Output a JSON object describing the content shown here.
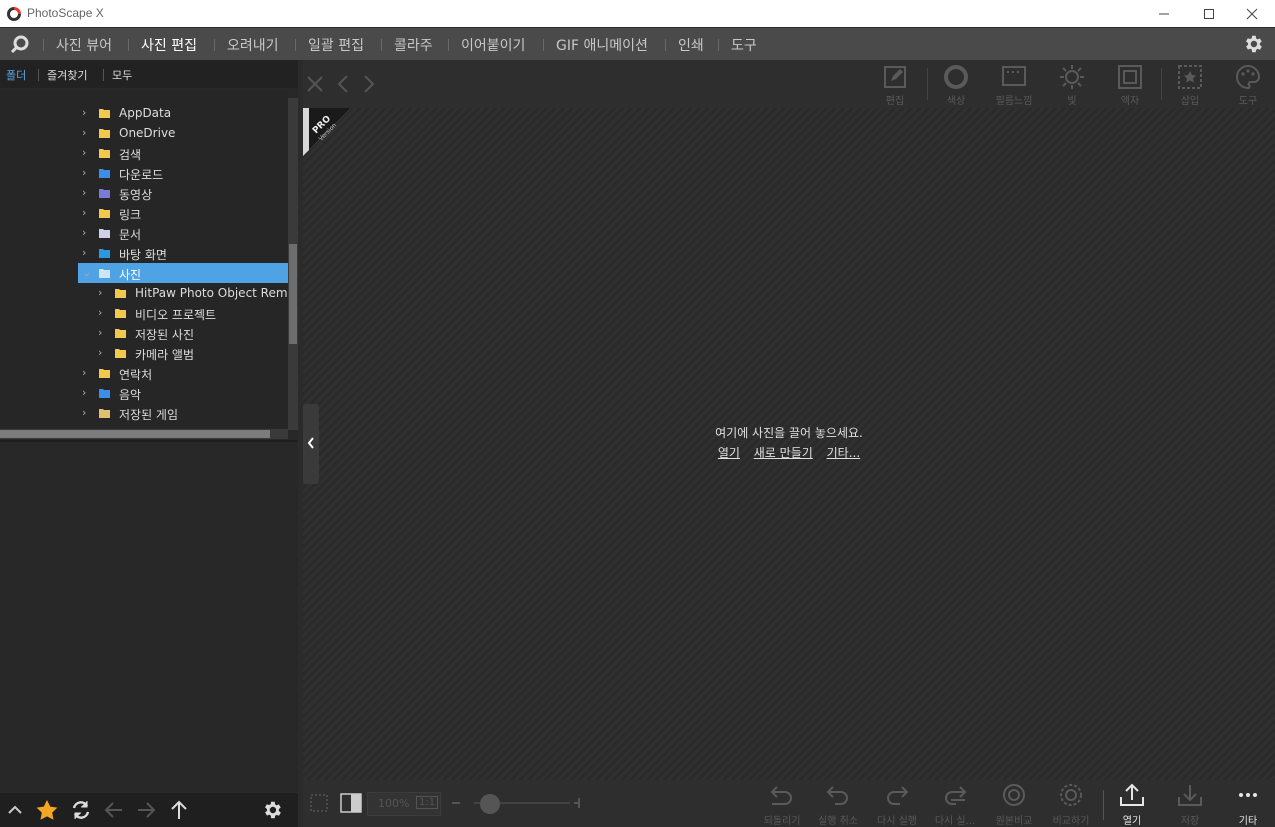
{
  "app": {
    "title": "PhotoScape X"
  },
  "menu": {
    "items": [
      "사진 뷰어",
      "사진 편집",
      "오려내기",
      "일괄 편집",
      "콜라주",
      "이어붙이기",
      "GIF 애니메이션",
      "인쇄",
      "도구"
    ],
    "active": "사진 편집"
  },
  "left_tabs": [
    "폴더",
    "즐겨찾기",
    "모두"
  ],
  "tree": [
    {
      "label": "AppData",
      "level": 1,
      "icon": "folder-icon"
    },
    {
      "label": "OneDrive",
      "level": 1,
      "icon": "folder-cloud-icon"
    },
    {
      "label": "검색",
      "level": 1,
      "icon": "search-folder-icon"
    },
    {
      "label": "다운로드",
      "level": 1,
      "icon": "download-icon"
    },
    {
      "label": "동영상",
      "level": 1,
      "icon": "video-icon"
    },
    {
      "label": "링크",
      "level": 1,
      "icon": "link-folder-icon"
    },
    {
      "label": "문서",
      "level": 1,
      "icon": "document-icon"
    },
    {
      "label": "바탕 화면",
      "level": 1,
      "icon": "desktop-icon"
    },
    {
      "label": "사진",
      "level": 1,
      "icon": "pictures-icon",
      "selected": true,
      "expanded": true
    },
    {
      "label": "HitPaw Photo Object Remo",
      "level": 2,
      "icon": "folder-icon"
    },
    {
      "label": "비디오 프로젝트",
      "level": 2,
      "icon": "folder-icon"
    },
    {
      "label": "저장된 사진",
      "level": 2,
      "icon": "folder-icon"
    },
    {
      "label": "카메라 앨범",
      "level": 2,
      "icon": "folder-icon"
    },
    {
      "label": "연락처",
      "level": 1,
      "icon": "contacts-icon"
    },
    {
      "label": "음악",
      "level": 1,
      "icon": "music-icon"
    },
    {
      "label": "저장된 게임",
      "level": 1,
      "icon": "games-icon"
    }
  ],
  "top_tools": [
    "편집",
    "색상",
    "필름느낌",
    "빛",
    "액자",
    "삽입",
    "도구"
  ],
  "badge": {
    "line1": "PRO",
    "line2": "Version"
  },
  "drop": {
    "message": "여기에 사진을 끌어 놓으세요.",
    "links": [
      "열기",
      "새로 만들기",
      "기타..."
    ]
  },
  "bottom": {
    "zoom": "100%",
    "ratio": "1:1",
    "tools": [
      "되돌리기",
      "실행 취소",
      "다시 실행",
      "다시 실...",
      "원본비교",
      "비교하기",
      "열기",
      "저장",
      "기타"
    ]
  }
}
